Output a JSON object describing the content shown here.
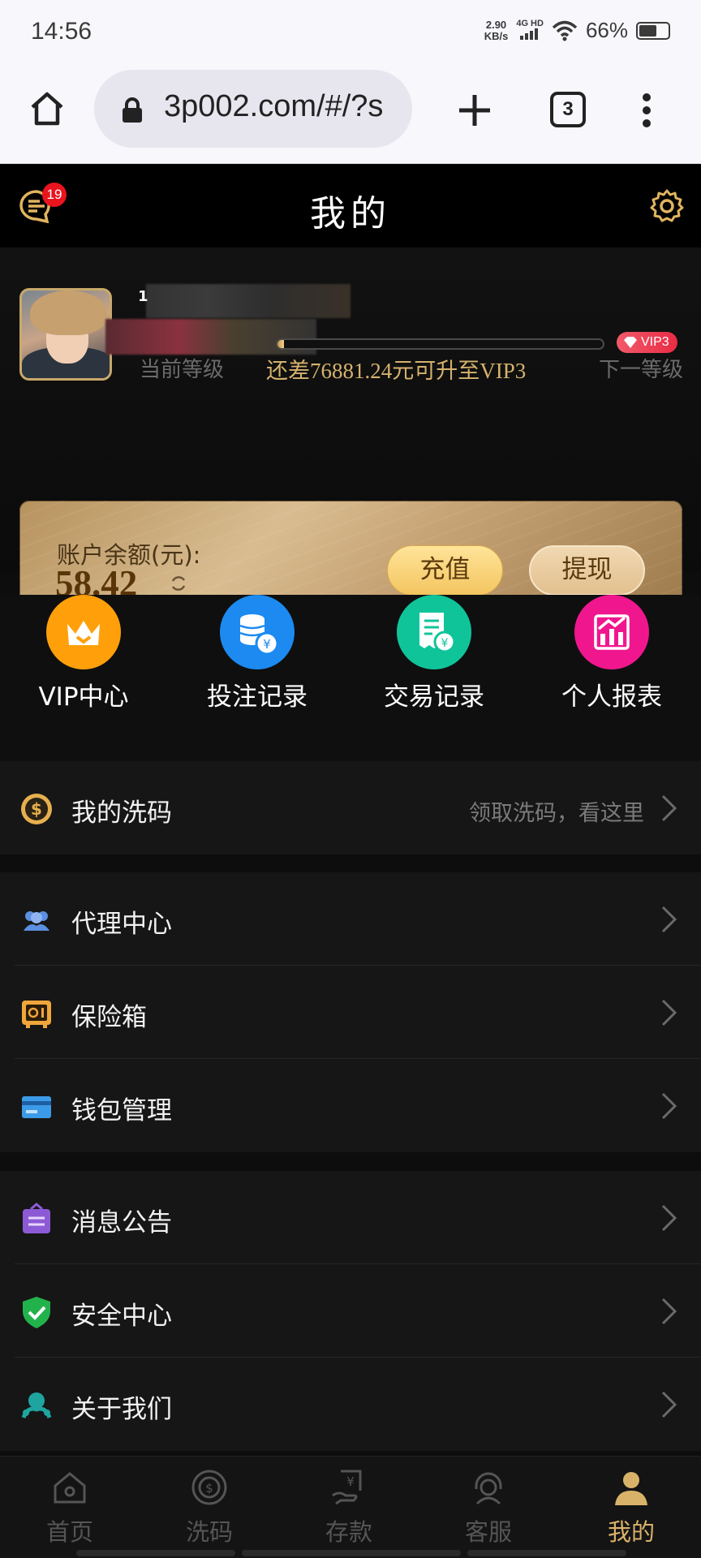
{
  "status_bar": {
    "time": "14:56",
    "net_speed": "2.90",
    "net_speed_unit": "KB/s",
    "network": "4G HD",
    "battery": "66%",
    "battery_level": 0.66
  },
  "browser": {
    "url": "3p002.com/#/?s",
    "tab_count": "3"
  },
  "header": {
    "title": "我的",
    "message_badge": "19"
  },
  "profile": {
    "username": "1",
    "current_level_label": "当前等级",
    "next_level_label": "下一等级",
    "upgrade_hint": "还差76881.24元可升至VIP3",
    "next_vip_badge": "VIP3",
    "progress": 0.02
  },
  "balance": {
    "label": "账户余额(元):",
    "amount": "58.42",
    "deposit_label": "充值",
    "withdraw_label": "提现"
  },
  "quick_actions": [
    {
      "label": "VIP中心",
      "icon": "crown-icon",
      "color": "#ffa00a"
    },
    {
      "label": "投注记录",
      "icon": "coins-icon",
      "color": "#1c8af0"
    },
    {
      "label": "交易记录",
      "icon": "receipt-icon",
      "color": "#10c49a"
    },
    {
      "label": "个人报表",
      "icon": "chart-icon",
      "color": "#f0178e"
    }
  ],
  "menu": {
    "rebate": {
      "label": "我的洗码",
      "hint": "领取洗码，看这里"
    },
    "group1": [
      {
        "label": "代理中心",
        "icon": "users-icon"
      },
      {
        "label": "保险箱",
        "icon": "safe-icon"
      },
      {
        "label": "钱包管理",
        "icon": "wallet-icon"
      }
    ],
    "group2": [
      {
        "label": "消息公告",
        "icon": "announcement-icon"
      },
      {
        "label": "安全中心",
        "icon": "shield-icon"
      },
      {
        "label": "关于我们",
        "icon": "about-icon"
      }
    ]
  },
  "bottom_nav": [
    {
      "label": "首页",
      "icon": "home-icon"
    },
    {
      "label": "洗码",
      "icon": "rebate-icon"
    },
    {
      "label": "存款",
      "icon": "deposit-icon"
    },
    {
      "label": "客服",
      "icon": "support-icon"
    },
    {
      "label": "我的",
      "icon": "profile-icon",
      "active": true
    }
  ]
}
